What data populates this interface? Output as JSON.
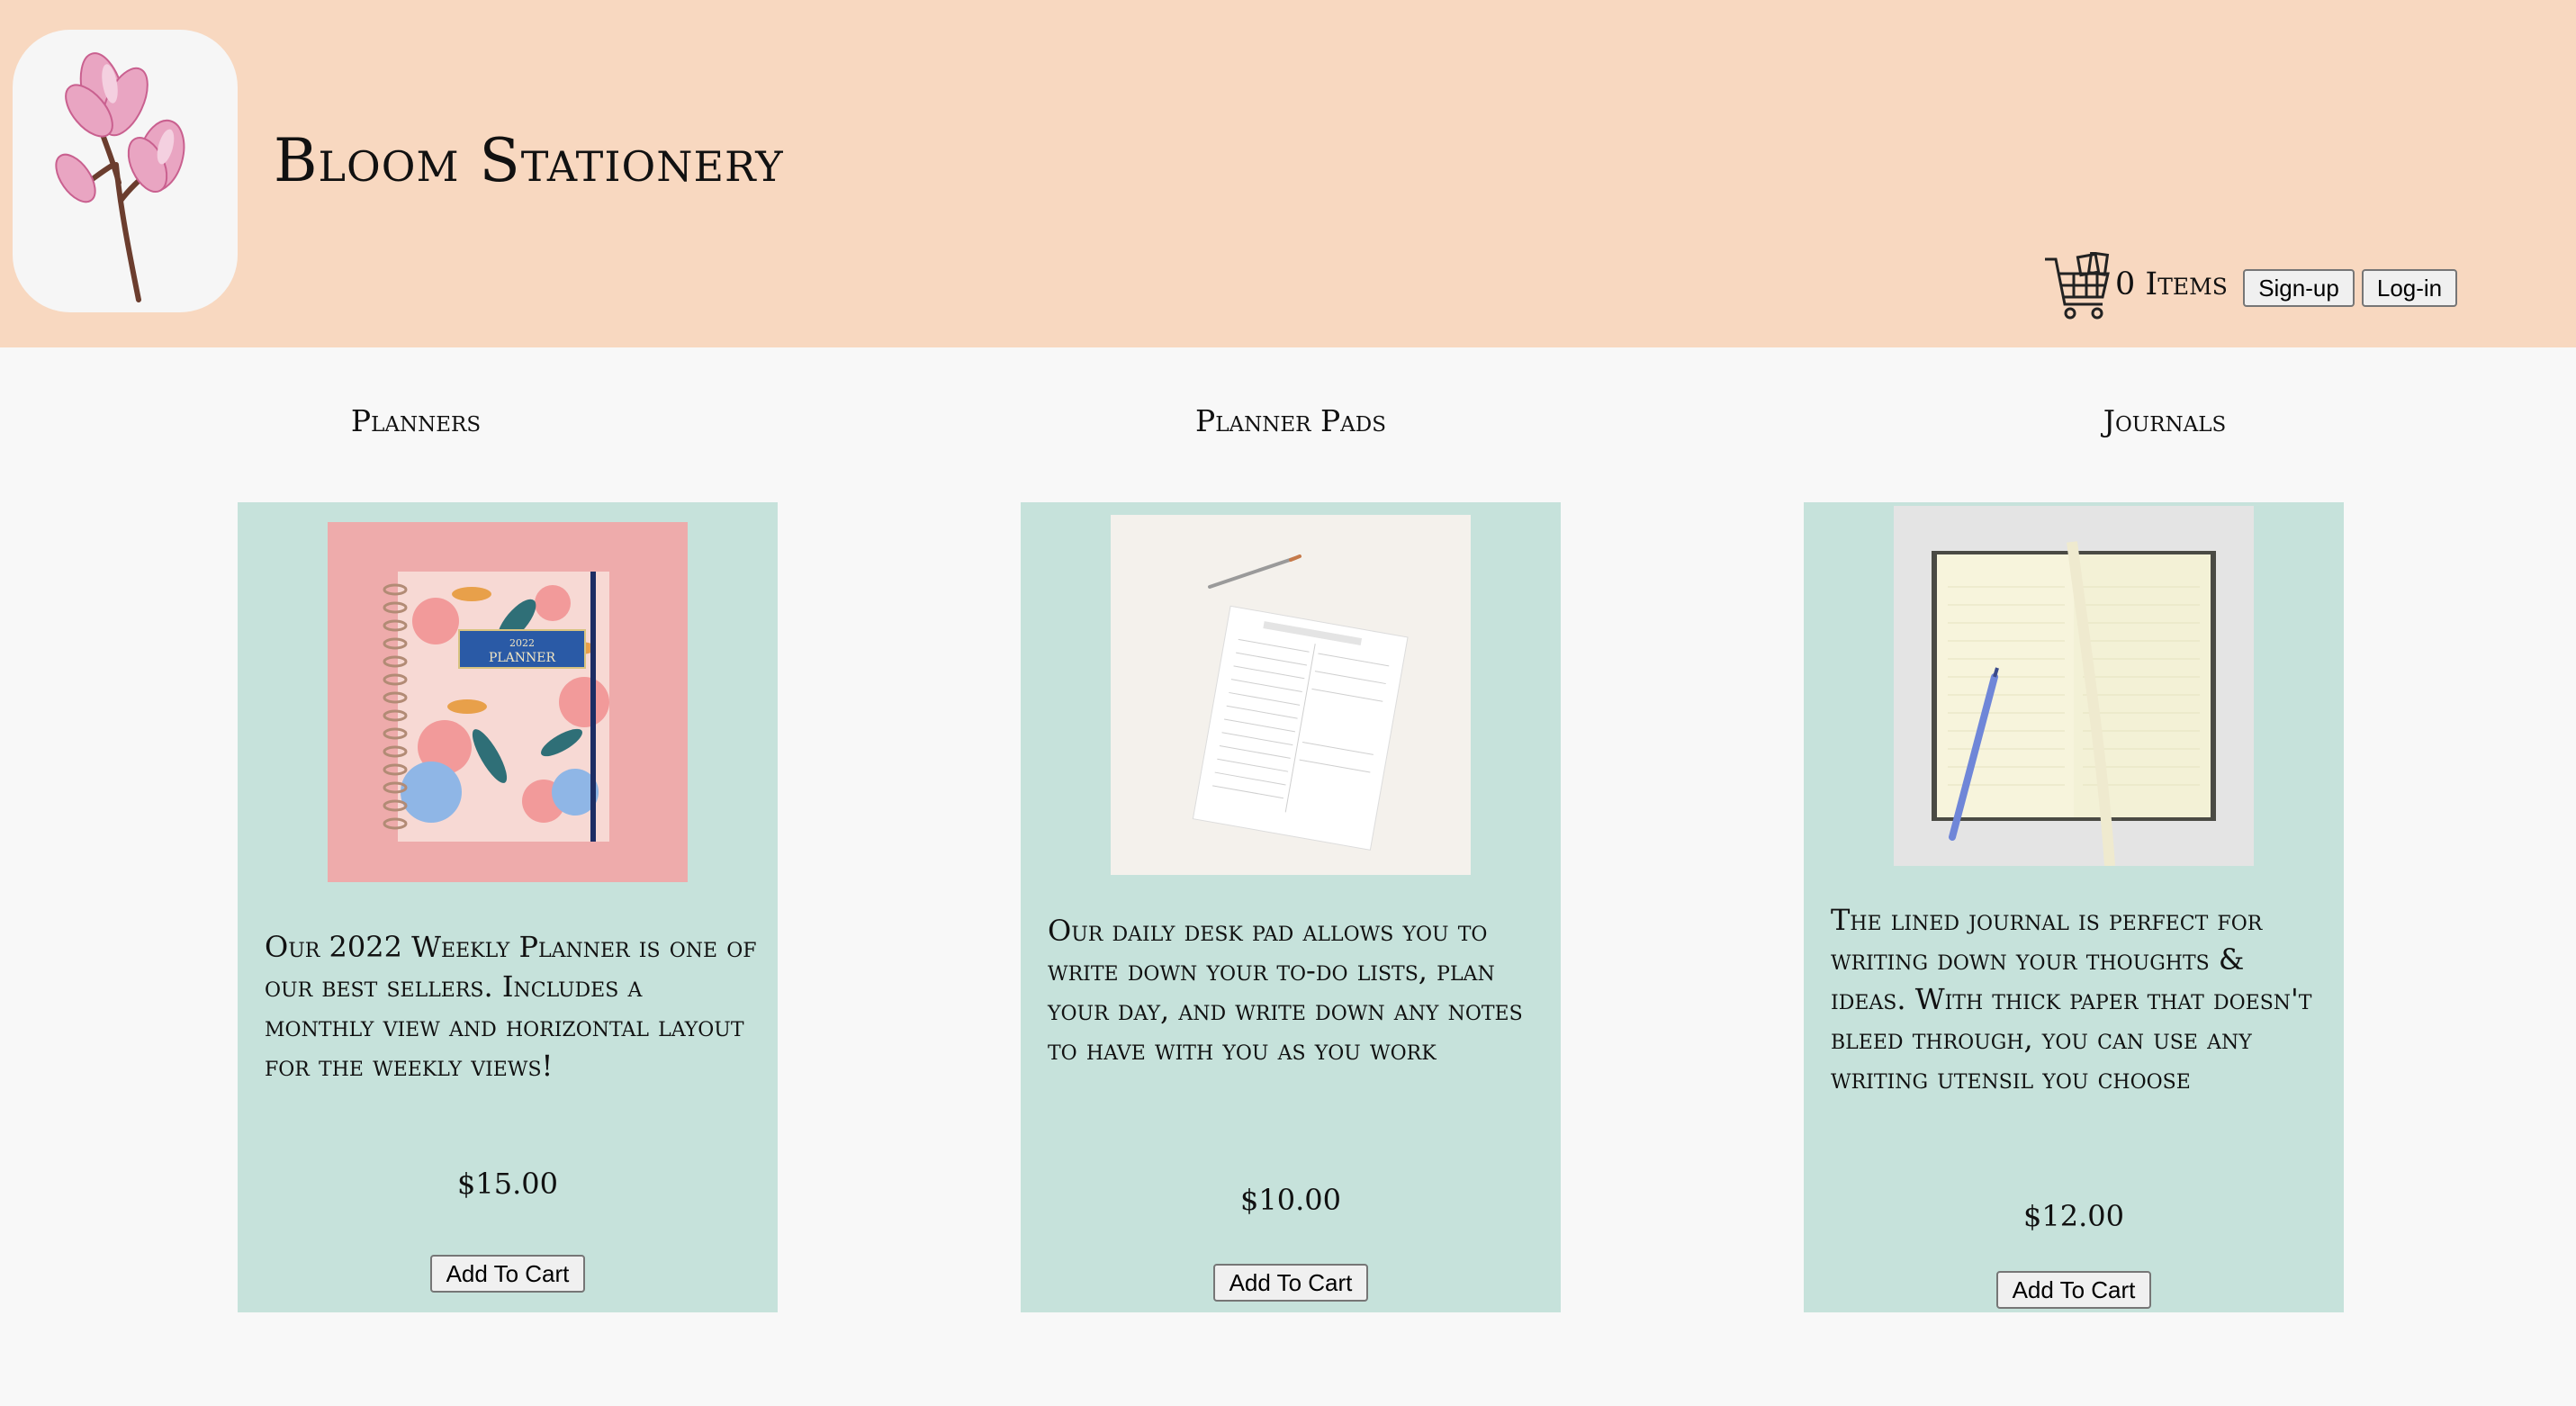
{
  "site": {
    "title": "Bloom Stationery",
    "logo_icon": "magnolia-flower-icon"
  },
  "header": {
    "cart_icon": "shopping-cart-icon",
    "items_count": "0 Items",
    "signup_label": "Sign-up",
    "login_label": "Log-in"
  },
  "colors": {
    "header_bg": "#f8d8c0",
    "card_bg": "#c6e2db",
    "page_bg": "#f8f8f8"
  },
  "categories": [
    {
      "heading": "Planners",
      "image_icon": "floral-planner-image",
      "description": "Our 2022 Weekly Planner is one of our best sellers. Includes a monthly view and horizontal layout for the weekly views!",
      "price": "$15.00",
      "button_label": "Add To Cart",
      "cover_year": "2022",
      "cover_label": "PLANNER"
    },
    {
      "heading": "Planner Pads",
      "image_icon": "desk-pad-image",
      "description": "Our daily desk pad allows you to write down your to-do lists, plan your day, and write down any notes to have with you as you work",
      "price": "$10.00",
      "button_label": "Add To Cart"
    },
    {
      "heading": "Journals",
      "image_icon": "lined-journal-image",
      "description": "The lined journal is perfect for writing down your thoughts & ideas. With thick paper that doesn't bleed through, you can use any writing utensil you choose",
      "price": "$12.00",
      "button_label": "Add To Cart"
    }
  ]
}
